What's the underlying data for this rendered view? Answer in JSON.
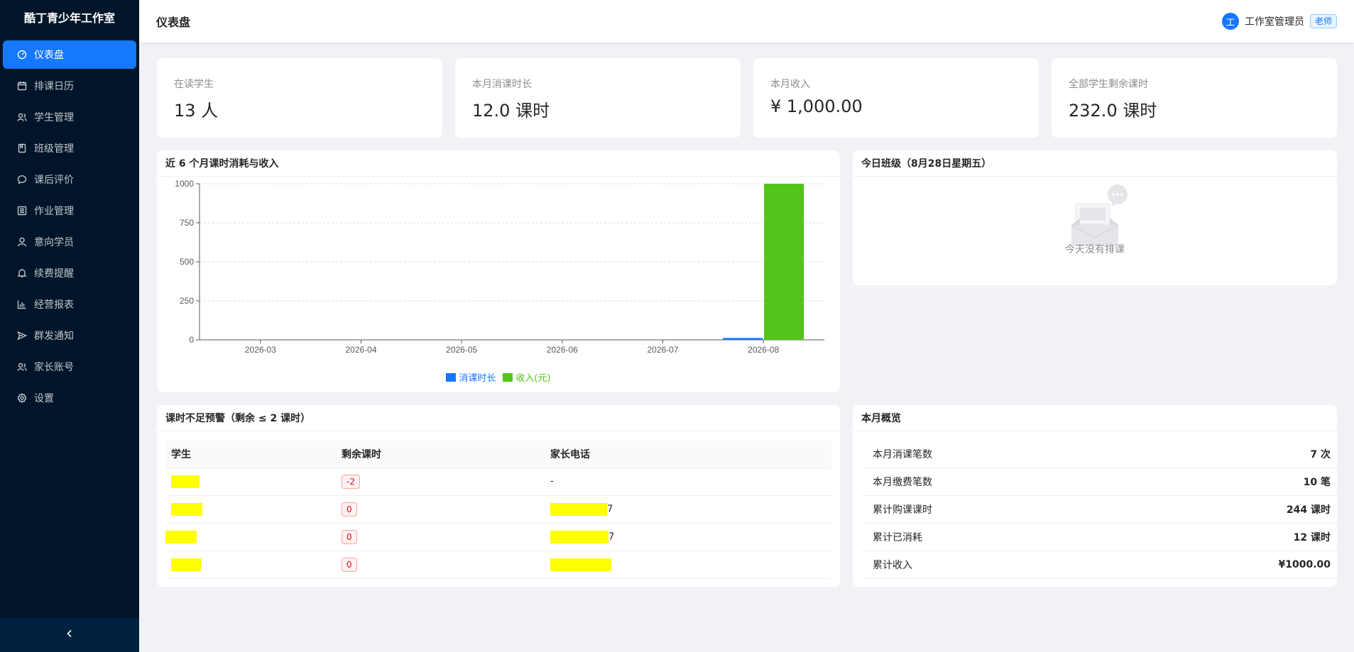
{
  "app": {
    "brand": "酷丁青少年工作室"
  },
  "sidebar": {
    "items": [
      {
        "label": "仪表盘",
        "icon": "dashboard-icon",
        "active": true
      },
      {
        "label": "排课日历",
        "icon": "calendar-icon"
      },
      {
        "label": "学生管理",
        "icon": "users-icon"
      },
      {
        "label": "班级管理",
        "icon": "book-icon"
      },
      {
        "label": "课后评价",
        "icon": "comment-icon"
      },
      {
        "label": "作业管理",
        "icon": "list-icon"
      },
      {
        "label": "意向学员",
        "icon": "user-icon"
      },
      {
        "label": "续费提醒",
        "icon": "bell-icon"
      },
      {
        "label": "经营报表",
        "icon": "bar-chart-icon"
      },
      {
        "label": "群发通知",
        "icon": "send-icon"
      },
      {
        "label": "家长账号",
        "icon": "team-icon"
      },
      {
        "label": "设置",
        "icon": "gear-icon"
      }
    ]
  },
  "header": {
    "title": "仪表盘",
    "avatar_letter": "工",
    "user_name": "工作室管理员",
    "role": "老师"
  },
  "stats": [
    {
      "label": "在读学生",
      "value": "13 人"
    },
    {
      "label": "本月消课时长",
      "value": "12.0 课时"
    },
    {
      "label": "本月收入",
      "value": "¥ 1,000.00"
    },
    {
      "label": "全部学生剩余课时",
      "value": "232.0 课时"
    }
  ],
  "chart_panel": {
    "title": "近 6 个月课时消耗与收入"
  },
  "chart_data": {
    "type": "bar",
    "title": "近 6 个月课时消耗与收入",
    "categories": [
      "2026-03",
      "2026-04",
      "2026-05",
      "2026-06",
      "2026-07",
      "2026-08"
    ],
    "series": [
      {
        "name": "消课时长",
        "values": [
          0,
          0,
          0,
          0,
          0,
          12
        ],
        "color": "#1677ff"
      },
      {
        "name": "收入(元)",
        "values": [
          0,
          0,
          0,
          0,
          0,
          1000
        ],
        "color": "#52c41a"
      }
    ],
    "yticks": [
      "0",
      "250",
      "500",
      "750",
      "1000"
    ],
    "ylim": [
      0,
      1000
    ],
    "grid": true,
    "legend": "bottom-center"
  },
  "today": {
    "title": "今日班级（8月28日星期五）",
    "empty_text": "今天没有排课"
  },
  "warning": {
    "title": "课时不足预警（剩余 ≤ 2 课时）",
    "columns": [
      "学生",
      "剩余课时",
      "家长电话"
    ],
    "rows": [
      {
        "remaining": "-2",
        "phone_suffix": "",
        "phone": "-"
      },
      {
        "remaining": "0",
        "phone_suffix": "7"
      },
      {
        "remaining": "0",
        "phone_suffix": "7"
      },
      {
        "remaining": "0",
        "phone_suffix": ""
      }
    ]
  },
  "overview": {
    "title": "本月概览",
    "rows": [
      {
        "label": "本月消课笔数",
        "value": "7 次"
      },
      {
        "label": "本月缴费笔数",
        "value": "10 笔"
      },
      {
        "label": "累计购课课时",
        "value": "244 课时"
      },
      {
        "label": "累计已消耗",
        "value": "12 课时"
      },
      {
        "label": "累计收入",
        "value": "¥1000.00"
      }
    ]
  },
  "colors": {
    "sidebar_bg": "#001529",
    "accent": "#1677ff",
    "income": "#52c41a",
    "danger": "#cf1322"
  }
}
